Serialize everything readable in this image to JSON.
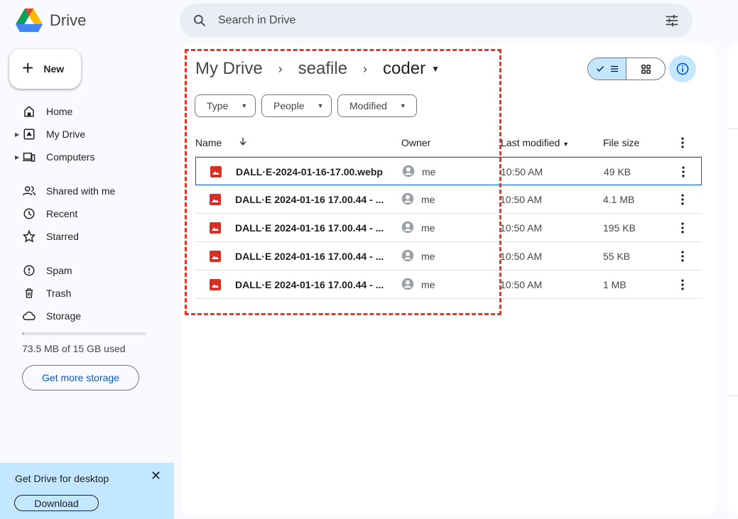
{
  "app": {
    "name": "Drive"
  },
  "search": {
    "placeholder": "Search in Drive"
  },
  "sidebar": {
    "new_label": "New",
    "items": [
      {
        "label": "Home",
        "icon": "home-icon"
      },
      {
        "label": "My Drive",
        "icon": "my-drive-icon"
      },
      {
        "label": "Computers",
        "icon": "computers-icon"
      },
      {
        "label": "Shared with me",
        "icon": "shared-icon"
      },
      {
        "label": "Recent",
        "icon": "clock-icon"
      },
      {
        "label": "Starred",
        "icon": "star-icon"
      },
      {
        "label": "Spam",
        "icon": "spam-icon"
      },
      {
        "label": "Trash",
        "icon": "trash-icon"
      },
      {
        "label": "Storage",
        "icon": "cloud-icon"
      }
    ],
    "storage": {
      "used_text": "73.5 MB of 15 GB used",
      "used_fraction": 0.005,
      "button": "Get more storage"
    }
  },
  "promo": {
    "title": "Get Drive for desktop",
    "button": "Download"
  },
  "breadcrumb": {
    "root": "My Drive",
    "middle": "seafile",
    "current": "coder"
  },
  "filters": [
    "Type",
    "People",
    "Modified"
  ],
  "table": {
    "columns": {
      "name": "Name",
      "owner": "Owner",
      "modified": "Last modified",
      "size": "File size"
    },
    "rows": [
      {
        "name": "DALL·E-2024-01-16-17.00.webp",
        "owner": "me",
        "modified": "10:50 AM",
        "size": "49 KB"
      },
      {
        "name": "DALL·E 2024-01-16 17.00.44 - ...",
        "owner": "me",
        "modified": "10:50 AM",
        "size": "4.1 MB"
      },
      {
        "name": "DALL·E 2024-01-16 17.00.44 - ...",
        "owner": "me",
        "modified": "10:50 AM",
        "size": "195 KB"
      },
      {
        "name": "DALL·E 2024-01-16 17.00.44 - ...",
        "owner": "me",
        "modified": "10:50 AM",
        "size": "55 KB"
      },
      {
        "name": "DALL·E 2024-01-16 17.00.44 - ...",
        "owner": "me",
        "modified": "10:50 AM",
        "size": "1 MB"
      }
    ]
  },
  "colors": {
    "accent": "#0b57d0",
    "selected_bg": "#c2e7ff",
    "annotation": "#ee3322",
    "image_icon": "#d93025"
  }
}
